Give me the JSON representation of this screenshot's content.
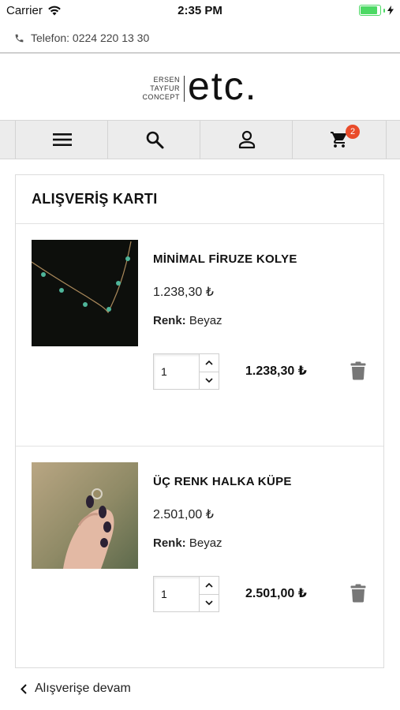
{
  "status_bar": {
    "carrier": "Carrier",
    "time": "2:35 PM",
    "battery_level": 0.95
  },
  "header": {
    "phone": "Telefon: 0224 220 13 30"
  },
  "logo": {
    "line1": "ERSEN",
    "line2": "TAYFUR",
    "line3": "CONCEPT",
    "mark": "etc."
  },
  "navbar": {
    "icons": [
      "menu-icon",
      "search-icon",
      "user-icon",
      "cart-icon"
    ],
    "cart_count": "2"
  },
  "cart": {
    "title": "ALIŞVERİŞ KARTI",
    "items": [
      {
        "name": "MİNİMAL FİRUZE KOLYE",
        "price": "1.238,30 ₺",
        "color_label": "Renk:",
        "color_value": "Beyaz",
        "quantity": "1",
        "total": "1.238,30 ₺"
      },
      {
        "name": "ÜÇ RENK HALKA KÜPE",
        "price": "2.501,00 ₺",
        "color_label": "Renk:",
        "color_value": "Beyaz",
        "quantity": "1",
        "total": "2.501,00 ₺"
      }
    ]
  },
  "footer": {
    "continue_label": "Alışverişe devam"
  },
  "colors": {
    "badge": "#e94b2a",
    "battery": "#4cd964",
    "navbar_bg": "#ececec"
  }
}
